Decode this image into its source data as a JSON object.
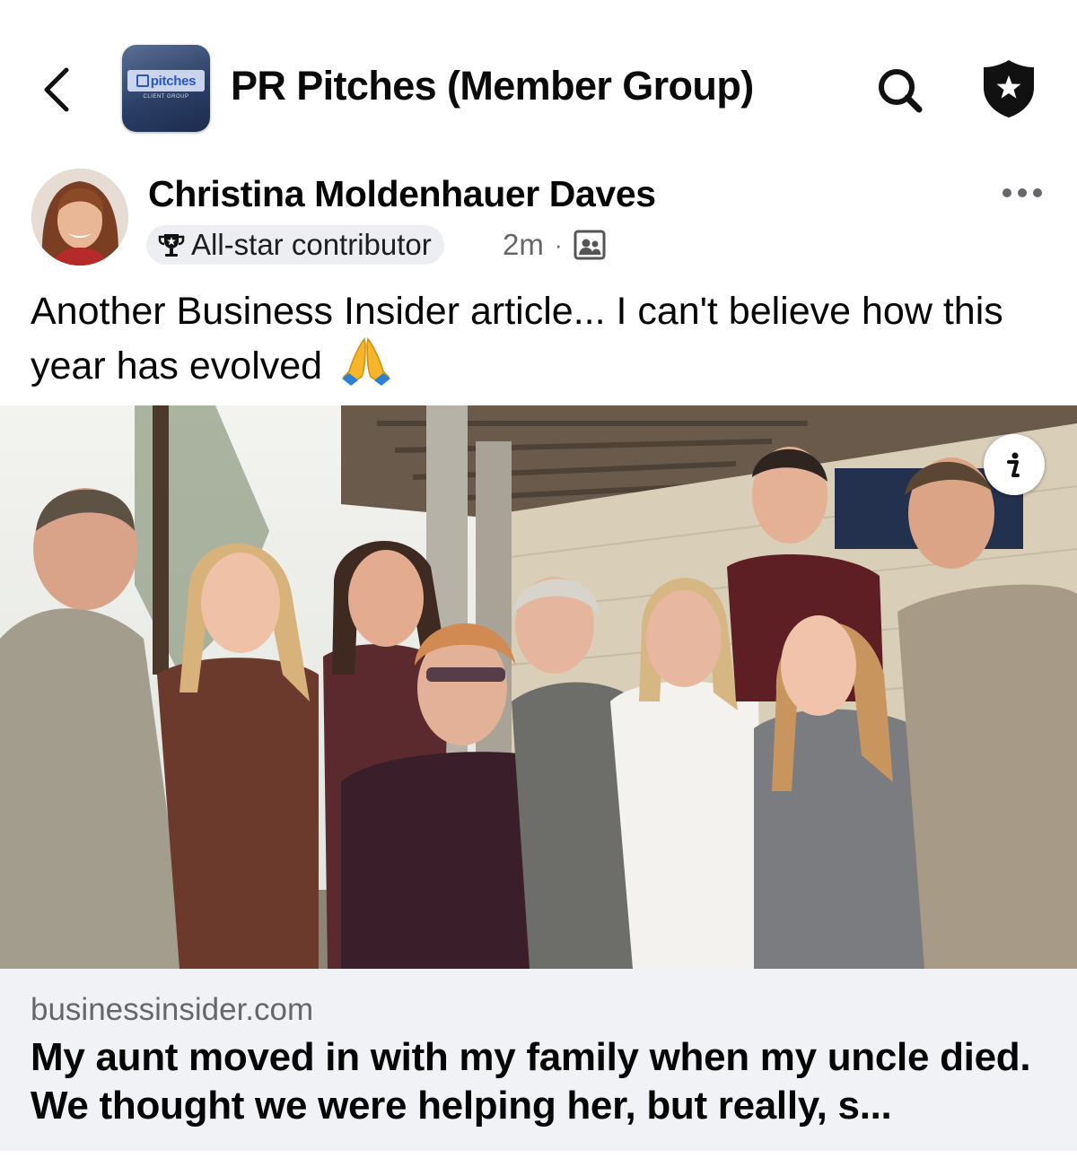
{
  "header": {
    "group_title": "PR Pitches (Member Group)",
    "group_logo_text": "pitches",
    "group_logo_subtext": "CLIENT GROUP",
    "icons": {
      "back": "chevron-left-icon",
      "search": "search-icon",
      "badge": "shield-star-icon"
    }
  },
  "post": {
    "author": "Christina Moldenhauer Daves",
    "badge_label": "All-star contributor",
    "time": "2m",
    "separator": "·",
    "audience_icon": "members-only-icon",
    "text": "Another Business Insider article... I can't believe how this year has evolved",
    "emoji": "pray-emoji",
    "more_icon": "more-dots-icon"
  },
  "link": {
    "domain": "businessinsider.com",
    "title": "My aunt moved in with my family when my uncle died. We thought we were helping her, but really, s..."
  },
  "colors": {
    "background": "#ffffff",
    "text_primary": "#050505",
    "text_secondary": "#65676b",
    "pill_bg": "#eceef1",
    "link_footer_bg": "#f0f2f5"
  }
}
